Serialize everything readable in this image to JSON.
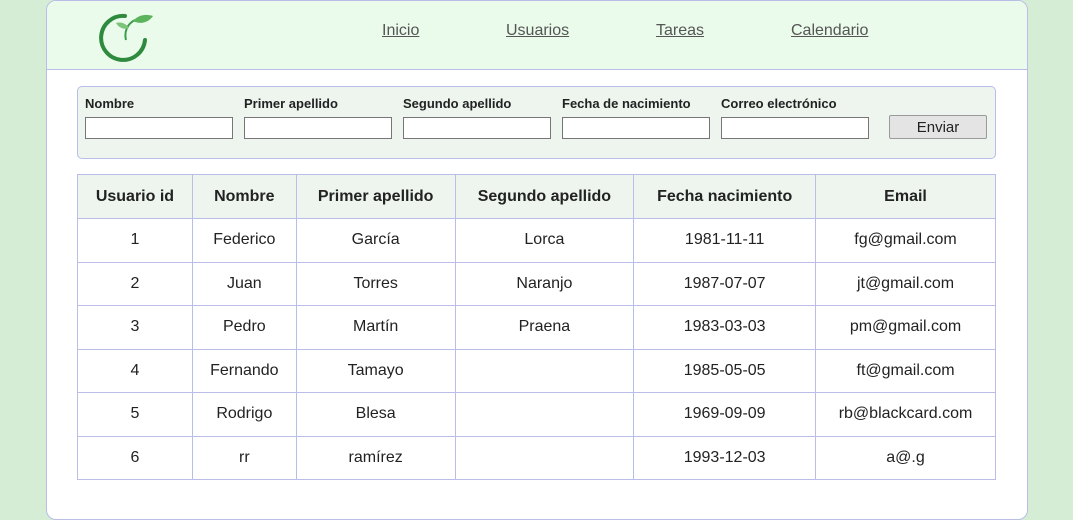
{
  "nav": {
    "items": [
      {
        "label": "Inicio"
      },
      {
        "label": "Usuarios"
      },
      {
        "label": "Tareas"
      },
      {
        "label": "Calendario"
      }
    ]
  },
  "form": {
    "fields": [
      {
        "label": "Nombre",
        "value": ""
      },
      {
        "label": "Primer apellido",
        "value": ""
      },
      {
        "label": "Segundo apellido",
        "value": ""
      },
      {
        "label": "Fecha de nacimiento",
        "value": ""
      },
      {
        "label": "Correo electrónico",
        "value": ""
      }
    ],
    "submit_label": "Enviar"
  },
  "table": {
    "headers": [
      "Usuario id",
      "Nombre",
      "Primer apellido",
      "Segundo apellido",
      "Fecha nacimiento",
      "Email"
    ],
    "rows": [
      [
        "1",
        "Federico",
        "García",
        "Lorca",
        "1981-11-11",
        "fg@gmail.com"
      ],
      [
        "2",
        "Juan",
        "Torres",
        "Naranjo",
        "1987-07-07",
        "jt@gmail.com"
      ],
      [
        "3",
        "Pedro",
        "Martín",
        "Praena",
        "1983-03-03",
        "pm@gmail.com"
      ],
      [
        "4",
        "Fernando",
        "Tamayo",
        "",
        "1985-05-05",
        "ft@gmail.com"
      ],
      [
        "5",
        "Rodrigo",
        "Blesa",
        "",
        "1969-09-09",
        "rb@blackcard.com"
      ],
      [
        "6",
        "rr",
        "ramírez",
        "",
        "1993-12-03",
        "a@.g"
      ]
    ]
  },
  "colors": {
    "background": "#d5ecd5",
    "header": "#ebfbeb",
    "border": "#b9bde8",
    "logo_green": "#2e8b3e"
  }
}
